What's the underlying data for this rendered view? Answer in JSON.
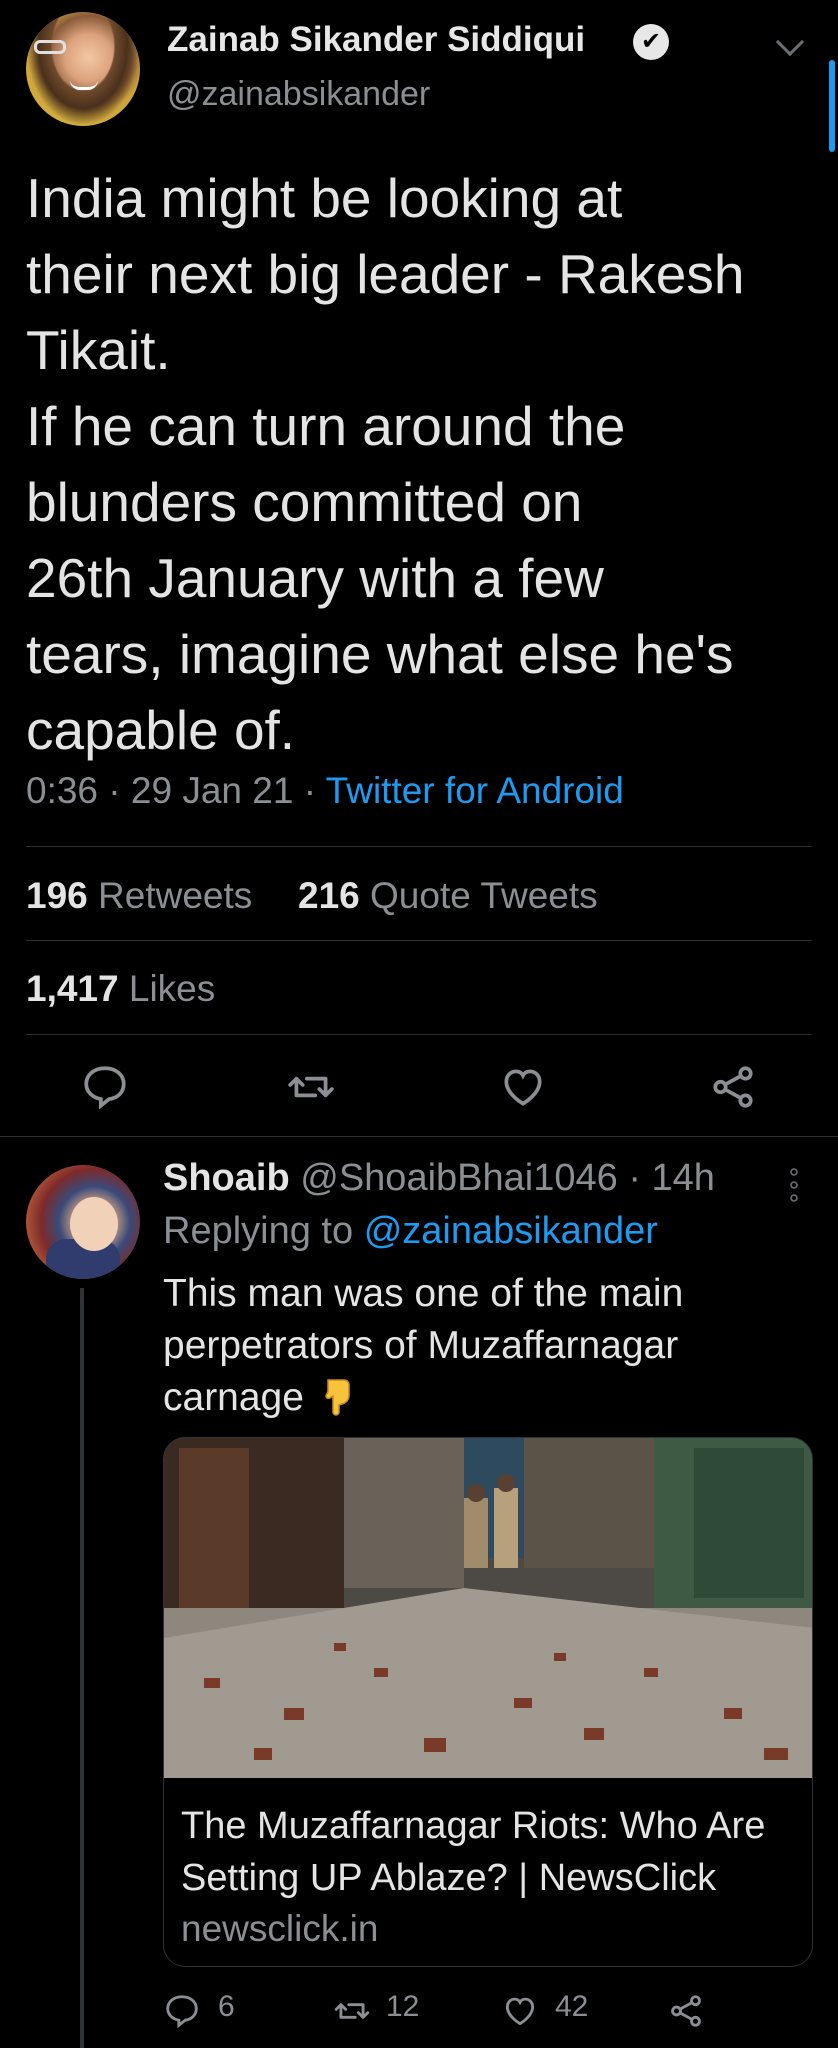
{
  "tweet": {
    "author_name": "Zainab Sikander Siddiqui",
    "author_handle": "@zainabsikander",
    "verified_badge": "✔",
    "text": "India might be looking at\ntheir next big leader - Rakesh\nTikait.\nIf he can turn around the\nblunders committed on\n26th January with a few\ntears, imagine what else he's\ncapable of.",
    "time": "0:36",
    "date": "29 Jan 21",
    "separator": "·",
    "source": "Twitter for Android",
    "retweets_count": "196",
    "retweets_label": "Retweets",
    "quotes_count": "216",
    "quotes_label": "Quote Tweets",
    "likes_count": "1,417",
    "likes_label": "Likes",
    "actions": [
      "reply-icon",
      "retweet-icon",
      "like-icon",
      "share-icon"
    ]
  },
  "reply": {
    "author_name": "Shoaib",
    "author_handle": "@ShoaibBhai1046",
    "separator": "·",
    "age": "14h",
    "replying_prefix": "Replying to",
    "replying_to": "@zainabsikander",
    "text": "This man was one of the main\nperpetrators of Muzaffarnagar\ncarnage",
    "emoji": "backhand-index-pointing-down-icon",
    "card": {
      "title": "The Muzaffarnagar Riots: Who Are Setting UP Ablaze? | NewsClick",
      "domain": "newsclick.in"
    },
    "reply_count": "6",
    "retweet_count": "12",
    "like_count": "42"
  },
  "colors": {
    "background": "#000000",
    "accent": "#1d9bf0",
    "muted": "#8b8f94",
    "text": "#e4e4e4"
  }
}
